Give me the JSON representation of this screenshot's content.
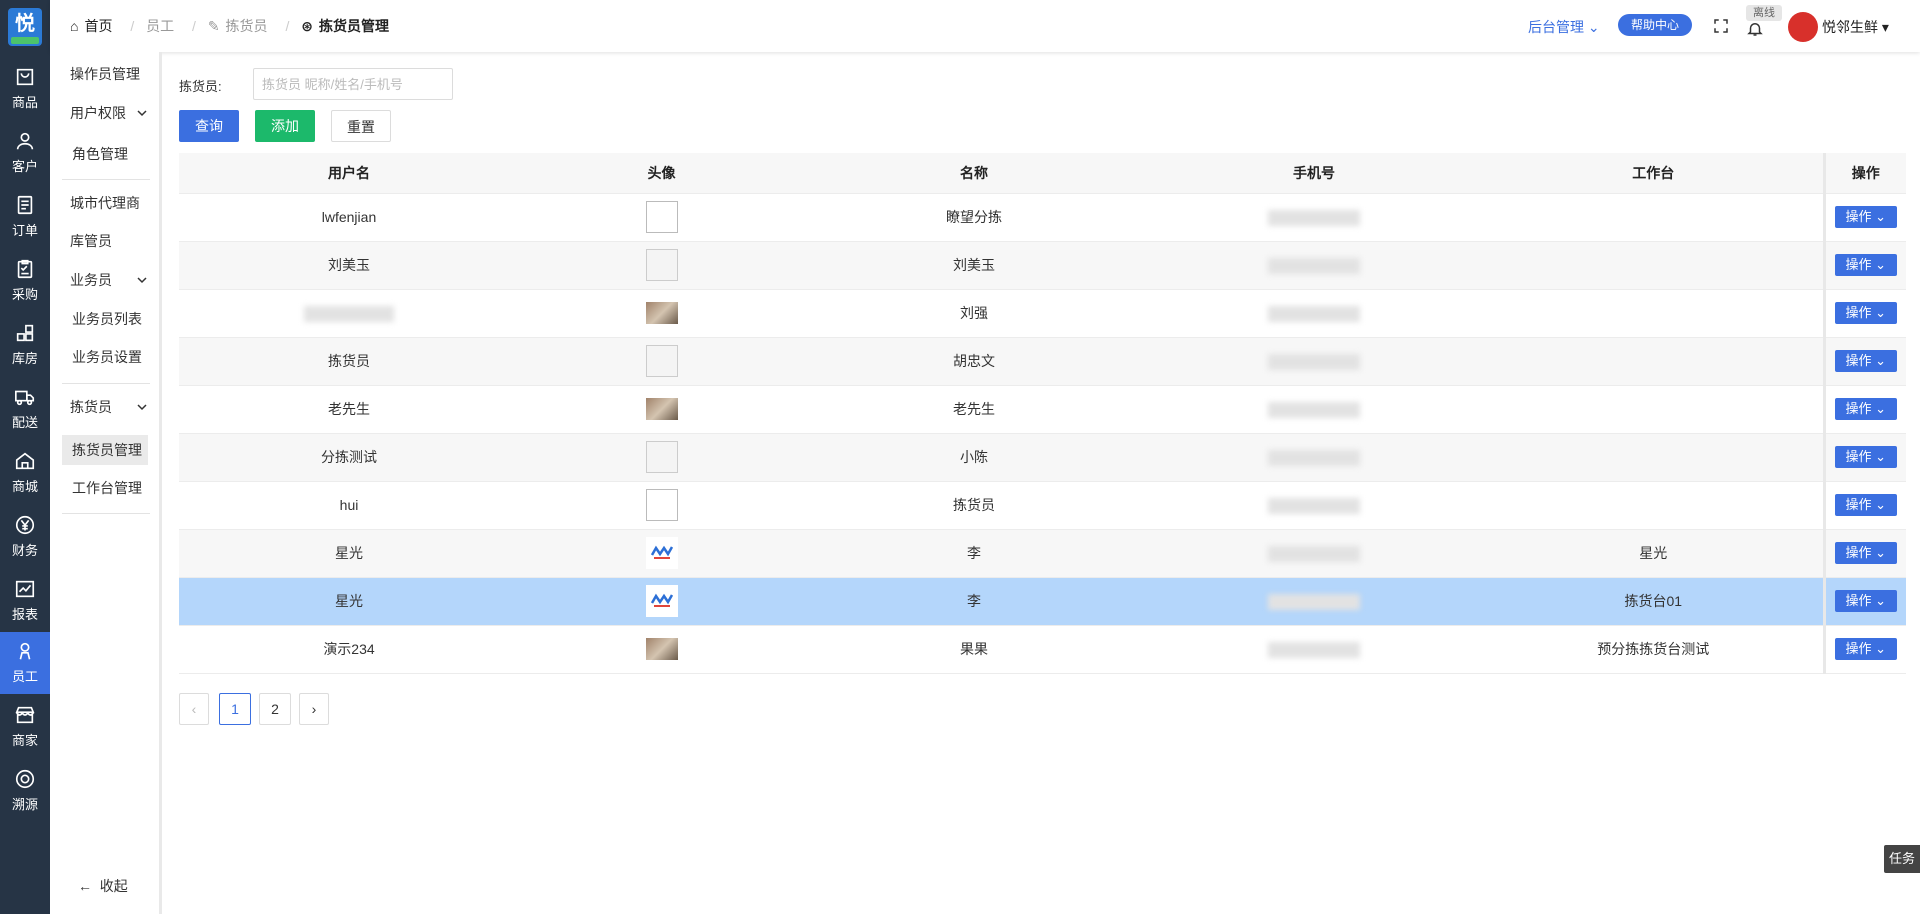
{
  "rail": {
    "logo": "悦",
    "items": [
      {
        "label": "商品"
      },
      {
        "label": "客户"
      },
      {
        "label": "订单"
      },
      {
        "label": "采购"
      },
      {
        "label": "库房"
      },
      {
        "label": "配送"
      },
      {
        "label": "商城"
      },
      {
        "label": "财务"
      },
      {
        "label": "报表"
      },
      {
        "label": "员工",
        "active": true
      },
      {
        "label": "商家"
      },
      {
        "label": "溯源"
      }
    ]
  },
  "sidebar": {
    "items": [
      {
        "label": "操作员管理"
      },
      {
        "label": "用户权限"
      },
      {
        "label": "角色管理"
      },
      {
        "label": "城市代理商"
      },
      {
        "label": "库管员"
      },
      {
        "label": "业务员"
      },
      {
        "label": "业务员列表"
      },
      {
        "label": "业务员设置"
      },
      {
        "label": "拣货员"
      },
      {
        "label": "拣货员管理",
        "active": true
      },
      {
        "label": "工作台管理"
      }
    ],
    "collapse_label": "收起"
  },
  "header": {
    "breadcrumb": [
      "首页",
      "员工",
      "拣货员",
      "拣货员管理"
    ],
    "backend_label": "后台管理",
    "help_label": "帮助中心",
    "offline_label": "离线",
    "brand_name": "悦邻生鲜"
  },
  "filter": {
    "label": "拣货员:",
    "placeholder": "拣货员 昵称/姓名/手机号",
    "query_label": "查询",
    "add_label": "添加",
    "reset_label": "重置"
  },
  "table": {
    "headers": [
      "用户名",
      "头像",
      "名称",
      "手机号",
      "工作台",
      "操作"
    ],
    "op_label": "操作",
    "rows": [
      {
        "username": "lwfenjian",
        "name": "瞭望分拣",
        "workbench": ""
      },
      {
        "username": "刘美玉",
        "name": "刘美玉",
        "workbench": ""
      },
      {
        "username": "",
        "name": "刘强",
        "workbench": ""
      },
      {
        "username": "拣货员",
        "name": "胡忠文",
        "workbench": ""
      },
      {
        "username": "老先生",
        "name": "老先生",
        "workbench": ""
      },
      {
        "username": "分拣测试",
        "name": "小陈",
        "workbench": ""
      },
      {
        "username": "hui",
        "name": "拣货员",
        "workbench": ""
      },
      {
        "username": "星光",
        "name": "李",
        "workbench": "星光"
      },
      {
        "username": "星光",
        "name": "李",
        "workbench": "拣货台01"
      },
      {
        "username": "演示234",
        "name": "果果",
        "workbench": "预分拣拣货台测试"
      }
    ]
  },
  "pagination": {
    "pages": [
      "1",
      "2"
    ],
    "current": "1"
  },
  "task_label": "任务",
  "colors": {
    "primary": "#3b6fe0",
    "success": "#1cb96b",
    "rail_bg": "#263445",
    "selected_row": "#b4d6fb"
  }
}
